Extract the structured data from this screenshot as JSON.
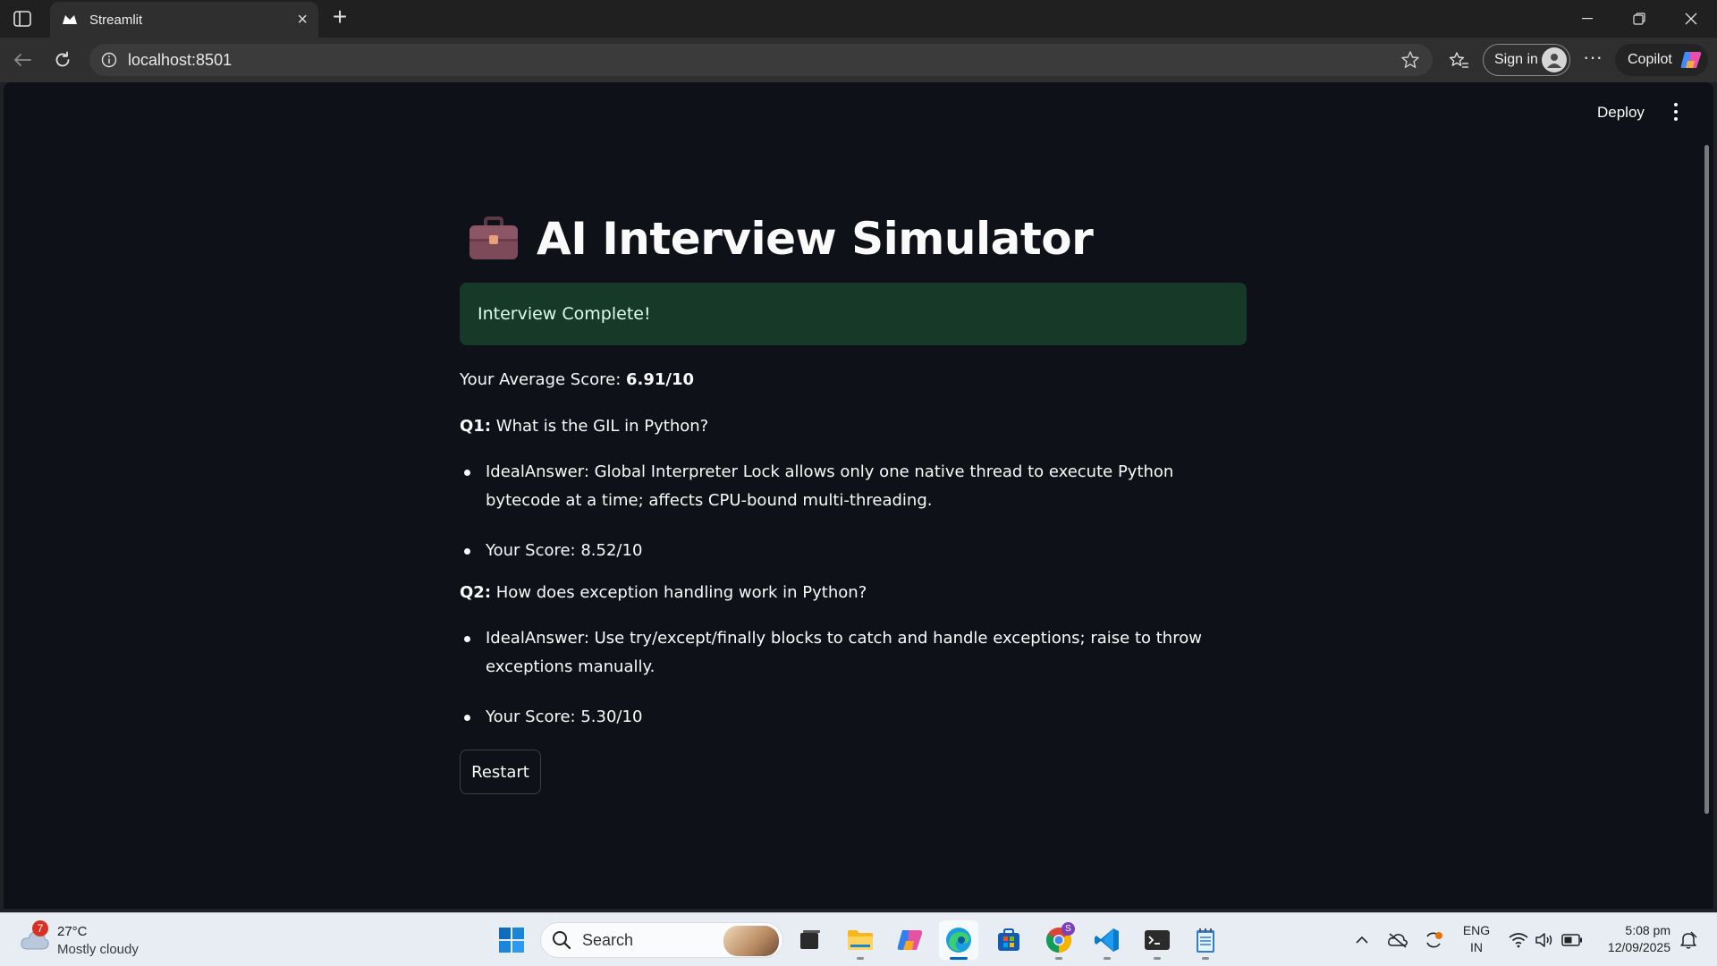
{
  "browser": {
    "tab_title": "Streamlit",
    "url": "localhost:8501",
    "sign_in_label": "Sign in",
    "copilot_label": "Copilot",
    "more_label": "···"
  },
  "app": {
    "deploy_label": "Deploy",
    "title": "AI Interview Simulator",
    "success_message": "Interview Complete!",
    "average_score_label": "Your Average Score:",
    "average_score_value": "6.91/10",
    "questions": [
      {
        "number_label": "Q1:",
        "text": "What is the GIL in Python?",
        "ideal_answer": "IdealAnswer: Global Interpreter Lock allows only one native thread to execute Python bytecode at a time; affects CPU-bound multi-threading.",
        "score": "Your Score: 8.52/10"
      },
      {
        "number_label": "Q2:",
        "text": "How does exception handling work in Python?",
        "ideal_answer": "IdealAnswer: Use try/except/finally blocks to catch and handle exceptions; raise to throw exceptions manually.",
        "score": "Your Score: 5.30/10"
      }
    ],
    "restart_label": "Restart"
  },
  "taskbar": {
    "weather_badge": "7",
    "temperature": "27°C",
    "condition": "Mostly cloudy",
    "search_label": "Search",
    "language_line1": "ENG",
    "language_line2": "IN",
    "time": "5:08 pm",
    "date": "12/09/2025",
    "chrome_badge": "S"
  },
  "colors": {
    "page_background": "#0e1117",
    "success_background": "#173928",
    "success_text": "#dffde9",
    "browser_frame": "#202020"
  }
}
